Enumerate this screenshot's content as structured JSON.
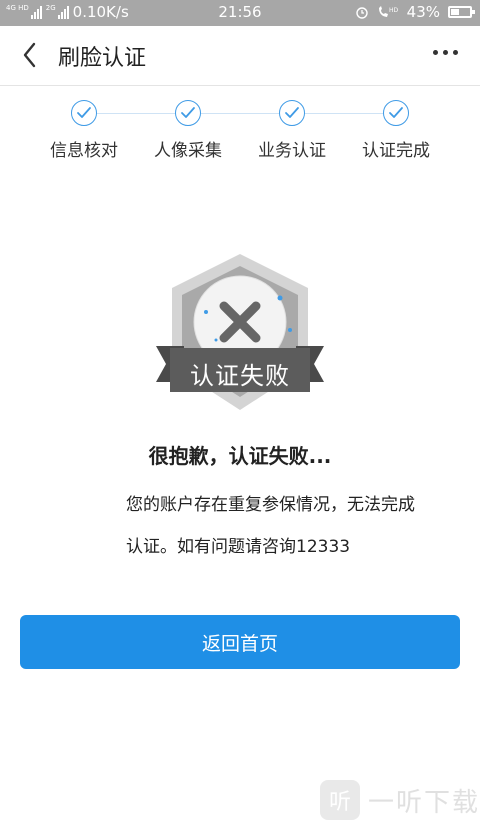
{
  "status_bar": {
    "network_tag_1": "4G HD",
    "network_tag_2": "2G",
    "speed": "0.10K/s",
    "time": "21:56",
    "battery": "43%",
    "battery_level": 0.43
  },
  "nav": {
    "title": "刷脸认证",
    "back_icon": "chevron-left-icon",
    "more_icon": "more-horizontal-icon"
  },
  "steps": [
    {
      "label": "信息核对",
      "status": "done"
    },
    {
      "label": "人像采集",
      "status": "done"
    },
    {
      "label": "业务认证",
      "status": "done"
    },
    {
      "label": "认证完成",
      "status": "done"
    }
  ],
  "badge": {
    "label": "认证失败",
    "icon": "x-icon"
  },
  "result": {
    "title": "很抱歉，认证失败...",
    "description": "您的账户存在重复参保情况，无法完成认证。如有问题请咨询12333"
  },
  "actions": {
    "home_button": "返回首页"
  },
  "watermark": {
    "logo": "听",
    "text": "一听下载"
  },
  "colors": {
    "accent": "#1f8fe6",
    "step_blue": "#3f9be6",
    "badge_gray": "#5c5c5c",
    "status_bar": "#a7a7a7"
  }
}
